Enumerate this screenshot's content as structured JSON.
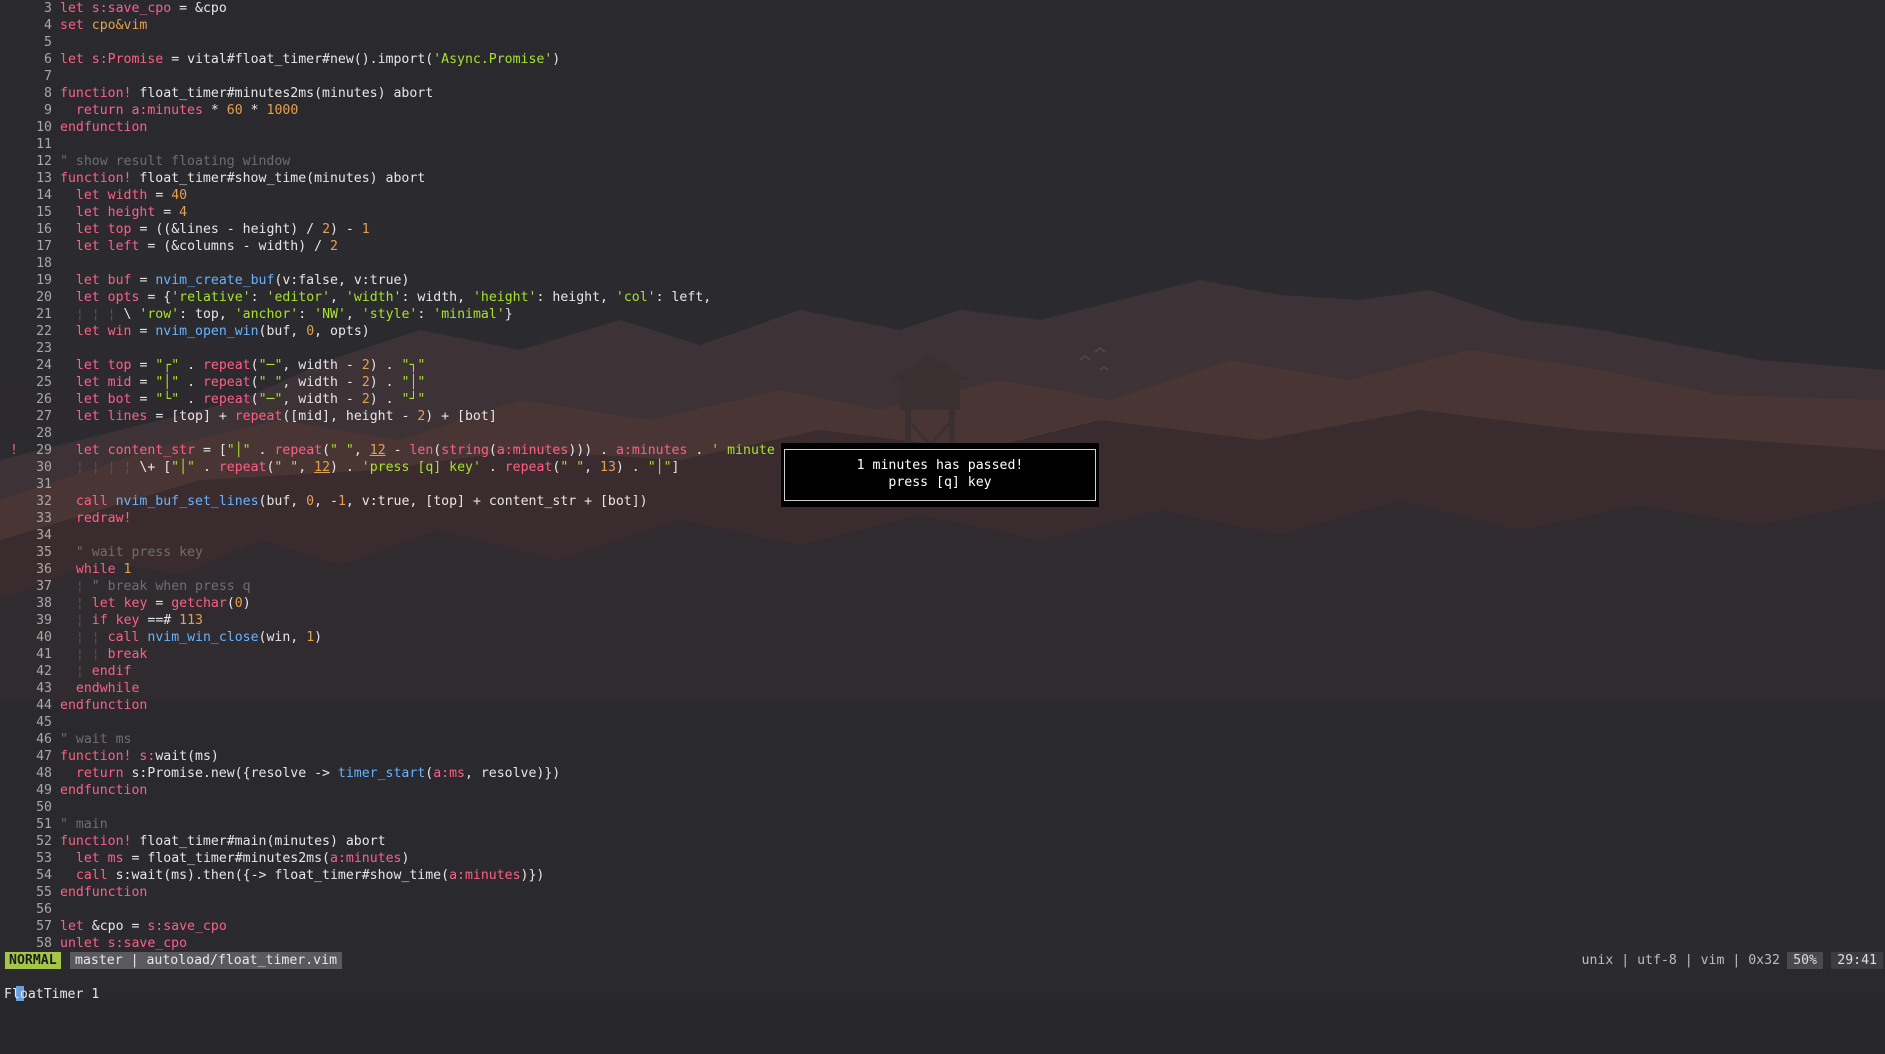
{
  "editor": {
    "lines": [
      {
        "num": "3",
        "html": "<span style='color:#ff5f87'>let</span> <span style='color:#ff5f87'>s:save_cpo</span> = &amp;cpo"
      },
      {
        "num": "4",
        "html": "<span style='color:#ff5f87'>set</span> <span style='color:#e5a050'>cpo&amp;vim</span>"
      },
      {
        "num": "5",
        "html": ""
      },
      {
        "num": "6",
        "html": "<span style='color:#ff5f87'>let</span> <span style='color:#ff5f87'>s:Promise</span> = vital#float_timer#new().import(<span style='color:#a6e22e'>'Async.Promise'</span>)"
      },
      {
        "num": "7",
        "html": ""
      },
      {
        "num": "8",
        "html": "<span style='color:#ff5f87'>function!</span> float_timer#minutes2ms(minutes) abort"
      },
      {
        "num": "9",
        "html": "  <span style='color:#ff5f87'>return</span> <span style='color:#ff5f87'>a:minutes</span> * <span style='color:#e5a050'>60</span> * <span style='color:#e5a050'>1000</span>"
      },
      {
        "num": "10",
        "html": "<span style='color:#ff5f87'>endfunction</span>"
      },
      {
        "num": "11",
        "html": ""
      },
      {
        "num": "12",
        "html": "<span style='color:#6e6e6e'>\" show result floating window</span>"
      },
      {
        "num": "13",
        "html": "<span style='color:#ff5f87'>function!</span> float_timer#show_time(minutes) abort"
      },
      {
        "num": "14",
        "html": "  <span style='color:#ff5f87'>let</span> <span style='color:#ff5f87'>width</span> = <span style='color:#e5a050'>40</span>"
      },
      {
        "num": "15",
        "html": "  <span style='color:#ff5f87'>let</span> <span style='color:#ff5f87'>height</span> = <span style='color:#e5a050'>4</span>"
      },
      {
        "num": "16",
        "html": "  <span style='color:#ff5f87'>let</span> <span style='color:#ff5f87'>top</span> = ((&amp;lines - height) / <span style='color:#e5a050'>2</span>) - <span style='color:#e5a050'>1</span>"
      },
      {
        "num": "17",
        "html": "  <span style='color:#ff5f87'>let</span> <span style='color:#ff5f87'>left</span> = (&amp;columns - width) / <span style='color:#e5a050'>2</span>"
      },
      {
        "num": "18",
        "html": ""
      },
      {
        "num": "19",
        "html": "  <span style='color:#ff5f87'>let</span> <span style='color:#ff5f87'>buf</span> = <span style='color:#66b3ff'>nvim_create_buf</span>(v:false, v:true)"
      },
      {
        "num": "20",
        "html": "  <span style='color:#ff5f87'>let</span> <span style='color:#ff5f87'>opts</span> = {<span style='color:#a6e22e'>'relative'</span>: <span style='color:#a6e22e'>'editor'</span>, <span style='color:#a6e22e'>'width'</span>: width, <span style='color:#a6e22e'>'height'</span>: height, <span style='color:#a6e22e'>'col'</span>: left,"
      },
      {
        "num": "21",
        "html": "  <span style='color:#555'>¦ ¦ ¦</span> \\ <span style='color:#a6e22e'>'row'</span>: top, <span style='color:#a6e22e'>'anchor'</span>: <span style='color:#a6e22e'>'NW'</span>, <span style='color:#a6e22e'>'style'</span>: <span style='color:#a6e22e'>'minimal'</span>}"
      },
      {
        "num": "22",
        "html": "  <span style='color:#ff5f87'>let</span> <span style='color:#ff5f87'>win</span> = <span style='color:#66b3ff'>nvim_open_win</span>(buf, <span style='color:#e5a050'>0</span>, opts)"
      },
      {
        "num": "23",
        "html": ""
      },
      {
        "num": "24",
        "html": "  <span style='color:#ff5f87'>let</span> <span style='color:#ff5f87'>top</span> = <span style='color:#a6e22e'>\"┌\"</span> . <span style='color:#ff5f87'>repeat</span>(<span style='color:#a6e22e'>\"─\"</span>, width - <span style='color:#e5a050'>2</span>) . <span style='color:#a6e22e'>\"┐\"</span>"
      },
      {
        "num": "25",
        "html": "  <span style='color:#ff5f87'>let</span> <span style='color:#ff5f87'>mid</span> = <span style='color:#a6e22e'>\"│\"</span> . <span style='color:#ff5f87'>repeat</span>(<span style='color:#a6e22e'>\" \"</span>, width - <span style='color:#e5a050'>2</span>) . <span style='color:#a6e22e'>\"│\"</span>"
      },
      {
        "num": "26",
        "html": "  <span style='color:#ff5f87'>let</span> <span style='color:#ff5f87'>bot</span> = <span style='color:#a6e22e'>\"└\"</span> . <span style='color:#ff5f87'>repeat</span>(<span style='color:#a6e22e'>\"─\"</span>, width - <span style='color:#e5a050'>2</span>) . <span style='color:#a6e22e'>\"┘\"</span>"
      },
      {
        "num": "27",
        "html": "  <span style='color:#ff5f87'>let</span> <span style='color:#ff5f87'>lines</span> = [top] + <span style='color:#ff5f87'>repeat</span>([mid], height - <span style='color:#e5a050'>2</span>) + [bot]"
      },
      {
        "num": "28",
        "html": ""
      },
      {
        "num": "29",
        "sign": "!",
        "html": "  <span style='color:#ff5f87'>let</span> <span style='color:#ff5f87'>content_str</span> = [<span style='color:#a6e22e'>\"│\"</span> . <span style='color:#ff5f87'>repeat</span>(<span style='color:#a6e22e'>\" \"</span>, <span style='color:#e5a050;text-decoration:underline'>12</span> - <span style='color:#ff5f87'>len</span>(<span style='color:#ff5f87'>string</span>(<span style='color:#ff5f87'>a:minutes</span>))) . <span style='color:#ff5f87'>a:minutes</span> . <span style='color:#a6e22e'>' minute</span>"
      },
      {
        "num": "30",
        "html": "  <span style='color:#555'>¦ ¦ ¦ ¦</span> \\+ [<span style='color:#a6e22e'>\"│\"</span> . <span style='color:#ff5f87'>repeat</span>(<span style='color:#a6e22e'>\" \"</span>, <span style='color:#e5a050;text-decoration:underline'>12</span>) . <span style='color:#a6e22e'>'press [q] key'</span> . <span style='color:#ff5f87'>repeat</span>(<span style='color:#a6e22e'>\" \"</span>, <span style='color:#e5a050'>13</span>) . <span style='color:#a6e22e'>\"│\"</span>]"
      },
      {
        "num": "31",
        "html": ""
      },
      {
        "num": "32",
        "html": "  <span style='color:#ff5f87'>call</span> <span style='color:#66b3ff'>nvim_buf_set_lines</span>(buf, <span style='color:#e5a050'>0</span>, -<span style='color:#e5a050'>1</span>, v:true, [top] + content_str + [bot])"
      },
      {
        "num": "33",
        "html": "  <span style='color:#ff5f87'>redraw!</span>"
      },
      {
        "num": "34",
        "html": ""
      },
      {
        "num": "35",
        "html": "  <span style='color:#6e6e6e'>\" wait press key</span>"
      },
      {
        "num": "36",
        "html": "  <span style='color:#ff5f87'>while</span> <span style='color:#e5a050'>1</span>"
      },
      {
        "num": "37",
        "html": "  <span style='color:#555'>¦</span> <span style='color:#6e6e6e'>\" break when press q</span>"
      },
      {
        "num": "38",
        "html": "  <span style='color:#555'>¦</span> <span style='color:#ff5f87'>let</span> <span style='color:#ff5f87'>key</span> = <span style='color:#ff5f87'>getchar</span>(<span style='color:#e5a050'>0</span>)"
      },
      {
        "num": "39",
        "html": "  <span style='color:#555'>¦</span> <span style='color:#ff5f87'>if</span> <span style='color:#ff5f87'>key</span> ==# <span style='color:#e5a050'>113</span>"
      },
      {
        "num": "40",
        "html": "  <span style='color:#555'>¦ ¦</span> <span style='color:#ff5f87'>call</span> <span style='color:#66b3ff'>nvim_win_close</span>(win, <span style='color:#e5a050'>1</span>)"
      },
      {
        "num": "41",
        "html": "  <span style='color:#555'>¦ ¦</span> <span style='color:#ff5f87'>break</span>"
      },
      {
        "num": "42",
        "html": "  <span style='color:#555'>¦</span> <span style='color:#ff5f87'>endif</span>"
      },
      {
        "num": "43",
        "html": "  <span style='color:#ff5f87'>endwhile</span>"
      },
      {
        "num": "44",
        "html": "<span style='color:#ff5f87'>endfunction</span>"
      },
      {
        "num": "45",
        "html": ""
      },
      {
        "num": "46",
        "html": "<span style='color:#6e6e6e'>\" wait ms</span>"
      },
      {
        "num": "47",
        "html": "<span style='color:#ff5f87'>function!</span> <span style='color:#ff5f87'>s:</span>wait(ms)"
      },
      {
        "num": "48",
        "html": "  <span style='color:#ff5f87'>return</span> s:Promise.new({resolve -&gt; <span style='color:#66b3ff'>timer_start</span>(<span style='color:#ff5f87'>a:ms</span>, resolve)})"
      },
      {
        "num": "49",
        "html": "<span style='color:#ff5f87'>endfunction</span>"
      },
      {
        "num": "50",
        "html": ""
      },
      {
        "num": "51",
        "html": "<span style='color:#6e6e6e'>\" main</span>"
      },
      {
        "num": "52",
        "html": "<span style='color:#ff5f87'>function!</span> float_timer#main(minutes) abort"
      },
      {
        "num": "53",
        "html": "  <span style='color:#ff5f87'>let</span> <span style='color:#ff5f87'>ms</span> = float_timer#minutes2ms(<span style='color:#ff5f87'>a:minutes</span>)"
      },
      {
        "num": "54",
        "html": "  <span style='color:#ff5f87'>call</span> s:wait(ms).then({-&gt; float_timer#show_time(<span style='color:#ff5f87'>a:minutes</span>)})"
      },
      {
        "num": "55",
        "html": "<span style='color:#ff5f87'>endfunction</span>"
      },
      {
        "num": "56",
        "html": ""
      },
      {
        "num": "57",
        "html": "<span style='color:#ff5f87'>let</span> &amp;cpo = <span style='color:#ff5f87'>s:save_cpo</span>"
      },
      {
        "num": "58",
        "html": "<span style='color:#ff5f87'>unlet</span> <span style='color:#ff5f87'>s:save_cpo</span>"
      }
    ]
  },
  "float_window": {
    "line1": "1 minutes has passed!",
    "line2": "press [q] key"
  },
  "statusline": {
    "mode": "NORMAL",
    "branch_file": "master | autoload/float_timer.vim",
    "fileinfo": "unix | utf-8 | vim | 0x32",
    "percent": "50%",
    "position": "29:41"
  },
  "cmdline": {
    "text": "FloatTimer 1"
  },
  "colors": {
    "keyword": "#ff5f87",
    "string": "#a6e22e",
    "number": "#e5a050",
    "function": "#66b3ff",
    "comment": "#6e6e6e",
    "mode_bg": "#a5c54a"
  }
}
